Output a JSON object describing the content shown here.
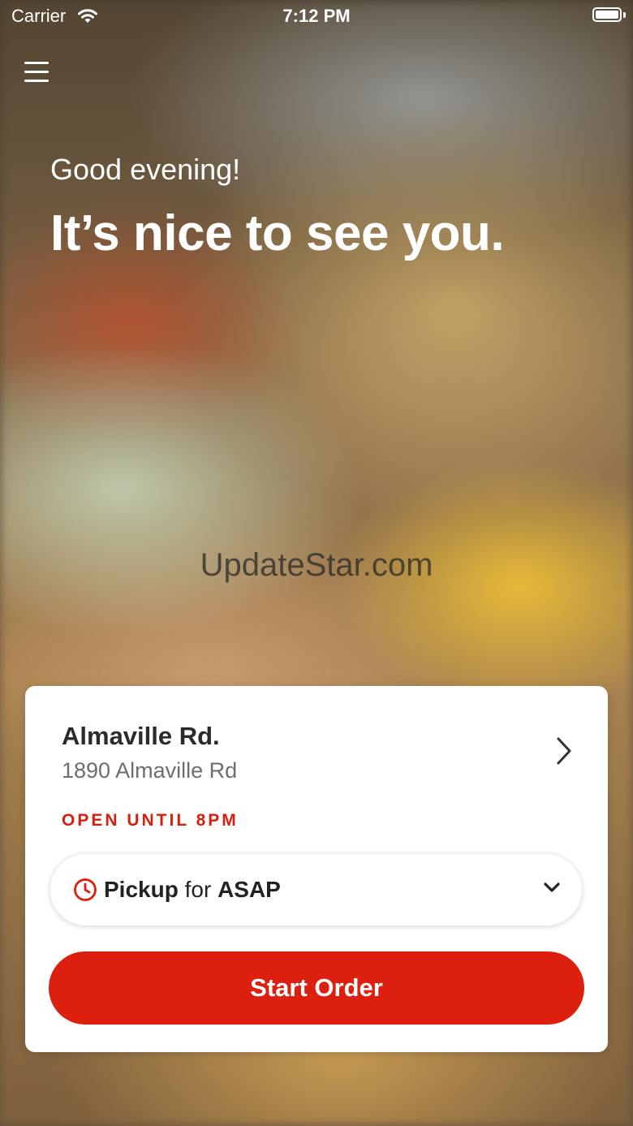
{
  "status_bar": {
    "carrier": "Carrier",
    "time": "7:12 PM"
  },
  "hero": {
    "greeting": "Good evening!",
    "headline": "It’s nice to see you.",
    "watermark": "UpdateStar.com"
  },
  "location": {
    "name": "Almaville Rd.",
    "address": "1890 Almaville Rd",
    "hours": "OPEN UNTIL 8PM"
  },
  "order_type": {
    "mode": "Pickup",
    "connector": "for",
    "time": "ASAP"
  },
  "actions": {
    "start_order_label": "Start Order"
  },
  "colors": {
    "accent": "#dc1f0e",
    "hours_text": "#d61f0f",
    "card_background": "#ffffff"
  },
  "icons": {
    "menu": "hamburger-menu-icon",
    "location_chevron": "chevron-right-icon",
    "time": "clock-icon",
    "dropdown": "chevron-down-icon"
  }
}
